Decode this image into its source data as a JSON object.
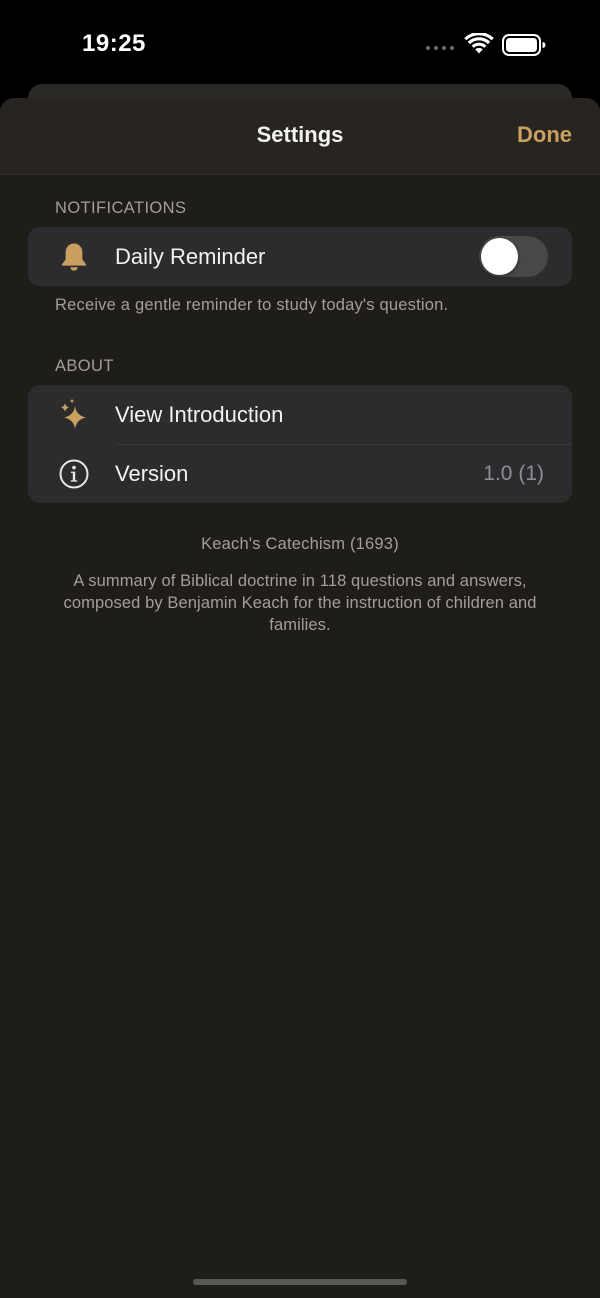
{
  "status_bar": {
    "time": "19:25"
  },
  "nav": {
    "title": "Settings",
    "done_label": "Done"
  },
  "notifications": {
    "header": "NOTIFICATIONS",
    "daily_reminder": {
      "icon": "bell-icon",
      "label": "Daily Reminder",
      "enabled": false
    },
    "footer": "Receive a gentle reminder to study today's question."
  },
  "about": {
    "header": "ABOUT",
    "rows": [
      {
        "icon": "sparkles-icon",
        "label": "View Introduction"
      },
      {
        "icon": "info-circle-icon",
        "label": "Version",
        "value": "1.0 (1)"
      }
    ],
    "title": "Keach's Catechism (1693)",
    "description": "A summary of Biblical doctrine in 118 questions and answers, composed by Benjamin Keach for the instruction of children and families."
  },
  "colors": {
    "accent": "#c9a060",
    "background": "#1f1d1a",
    "group_background": "#2c2c2e",
    "nav_background": "#282520"
  }
}
